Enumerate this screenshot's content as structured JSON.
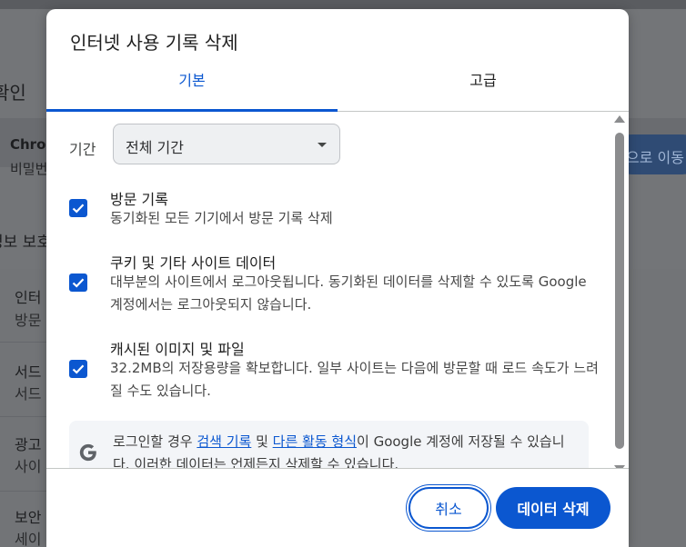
{
  "background": {
    "heading": "확인",
    "card_title": "Chrom",
    "card_sub": "비밀번",
    "card_button": "으로 이동",
    "section": "정보 보호",
    "rows": [
      {
        "title": "인터",
        "sub": "방문"
      },
      {
        "title": "서드",
        "sub": "서드"
      },
      {
        "title": "광고",
        "sub": "사이"
      },
      {
        "title": "보안",
        "sub": "세이"
      }
    ]
  },
  "dialog": {
    "title": "인터넷 사용 기록 삭제",
    "tabs": [
      {
        "label": "기본",
        "selected": true
      },
      {
        "label": "고급",
        "selected": false
      }
    ],
    "period": {
      "label": "기간",
      "value": "전체 기간"
    },
    "options": [
      {
        "title": "방문 기록",
        "description": "동기화된 모든 기기에서 방문 기록 삭제",
        "checked": true
      },
      {
        "title": "쿠키 및 기타 사이트 데이터",
        "description": "대부분의 사이트에서 로그아웃됩니다. 동기화된 데이터를 삭제할 수 있도록 Google 계정에서는 로그아웃되지 않습니다.",
        "checked": true
      },
      {
        "title": "캐시된 이미지 및 파일",
        "description": "32.2MB의 저장용량을 확보합니다. 일부 사이트는 다음에 방문할 때 로드 속도가 느려질 수도 있습니다.",
        "checked": true
      }
    ],
    "info": {
      "icon": "google-g-icon",
      "prefix": "로그인할 경우 ",
      "link1": "검색 기록",
      "middle": " 및 ",
      "link2": "다른 활동 형식",
      "suffix": "이 Google 계정에 저장될 수 있습니다. 이러한 데이터는 언제든지 삭제할 수 있습니다."
    },
    "buttons": {
      "cancel": "취소",
      "delete": "데이터 삭제"
    }
  },
  "colors": {
    "accent": "#0b57d0",
    "overlay": "#737578",
    "info_bg": "#f3f5f8"
  }
}
